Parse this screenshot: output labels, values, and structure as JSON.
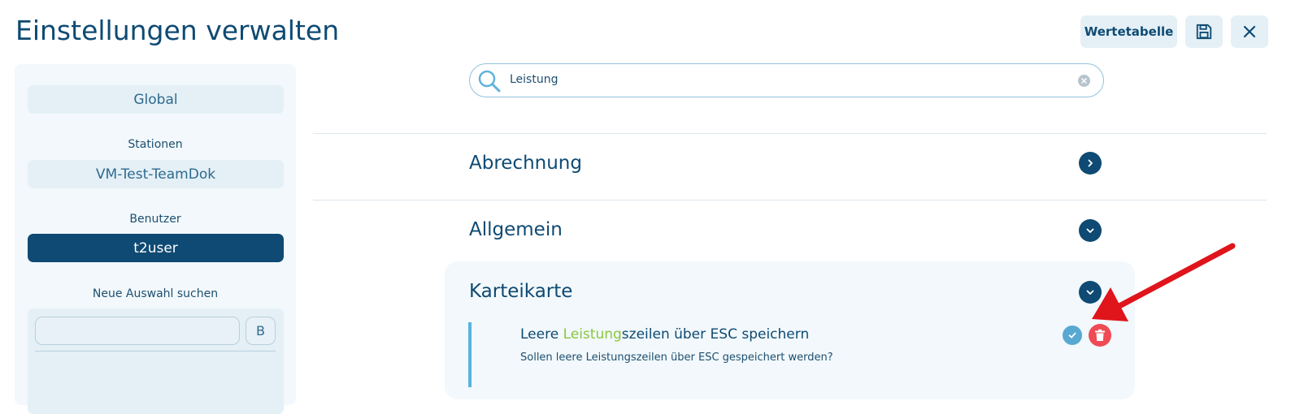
{
  "header": {
    "title": "Einstellungen verwalten",
    "wertetabelle_label": "Wertetabelle",
    "save_icon": "save-icon",
    "close_icon": "close-icon"
  },
  "sidebar": {
    "global_label": "Global",
    "stationen_heading": "Stationen",
    "station_value": "VM-Test-TeamDok",
    "benutzer_heading": "Benutzer",
    "benutzer_value": "t2user",
    "neue_auswahl_heading": "Neue Auswahl suchen",
    "search_value": "",
    "b_button_label": "B"
  },
  "search": {
    "value": "Leistung",
    "icon": "search-icon",
    "clear_icon": "clear-icon"
  },
  "sections": [
    {
      "title": "Abrechnung",
      "state": "collapsed"
    },
    {
      "title": "Allgemein",
      "state": "expanded"
    },
    {
      "title": "Karteikarte",
      "state": "expanded"
    }
  ],
  "setting": {
    "title_prefix": "Leere ",
    "title_highlight": "Leistung",
    "title_suffix": "szeilen über ESC speichern",
    "description": "Sollen leere Leistungszeilen über ESC gespeichert werden?"
  },
  "colors": {
    "primary": "#0e4a73",
    "highlight": "#8cc63f",
    "delete": "#ef4b55",
    "check": "#58a8d2",
    "annotation_arrow": "#e0141b"
  }
}
